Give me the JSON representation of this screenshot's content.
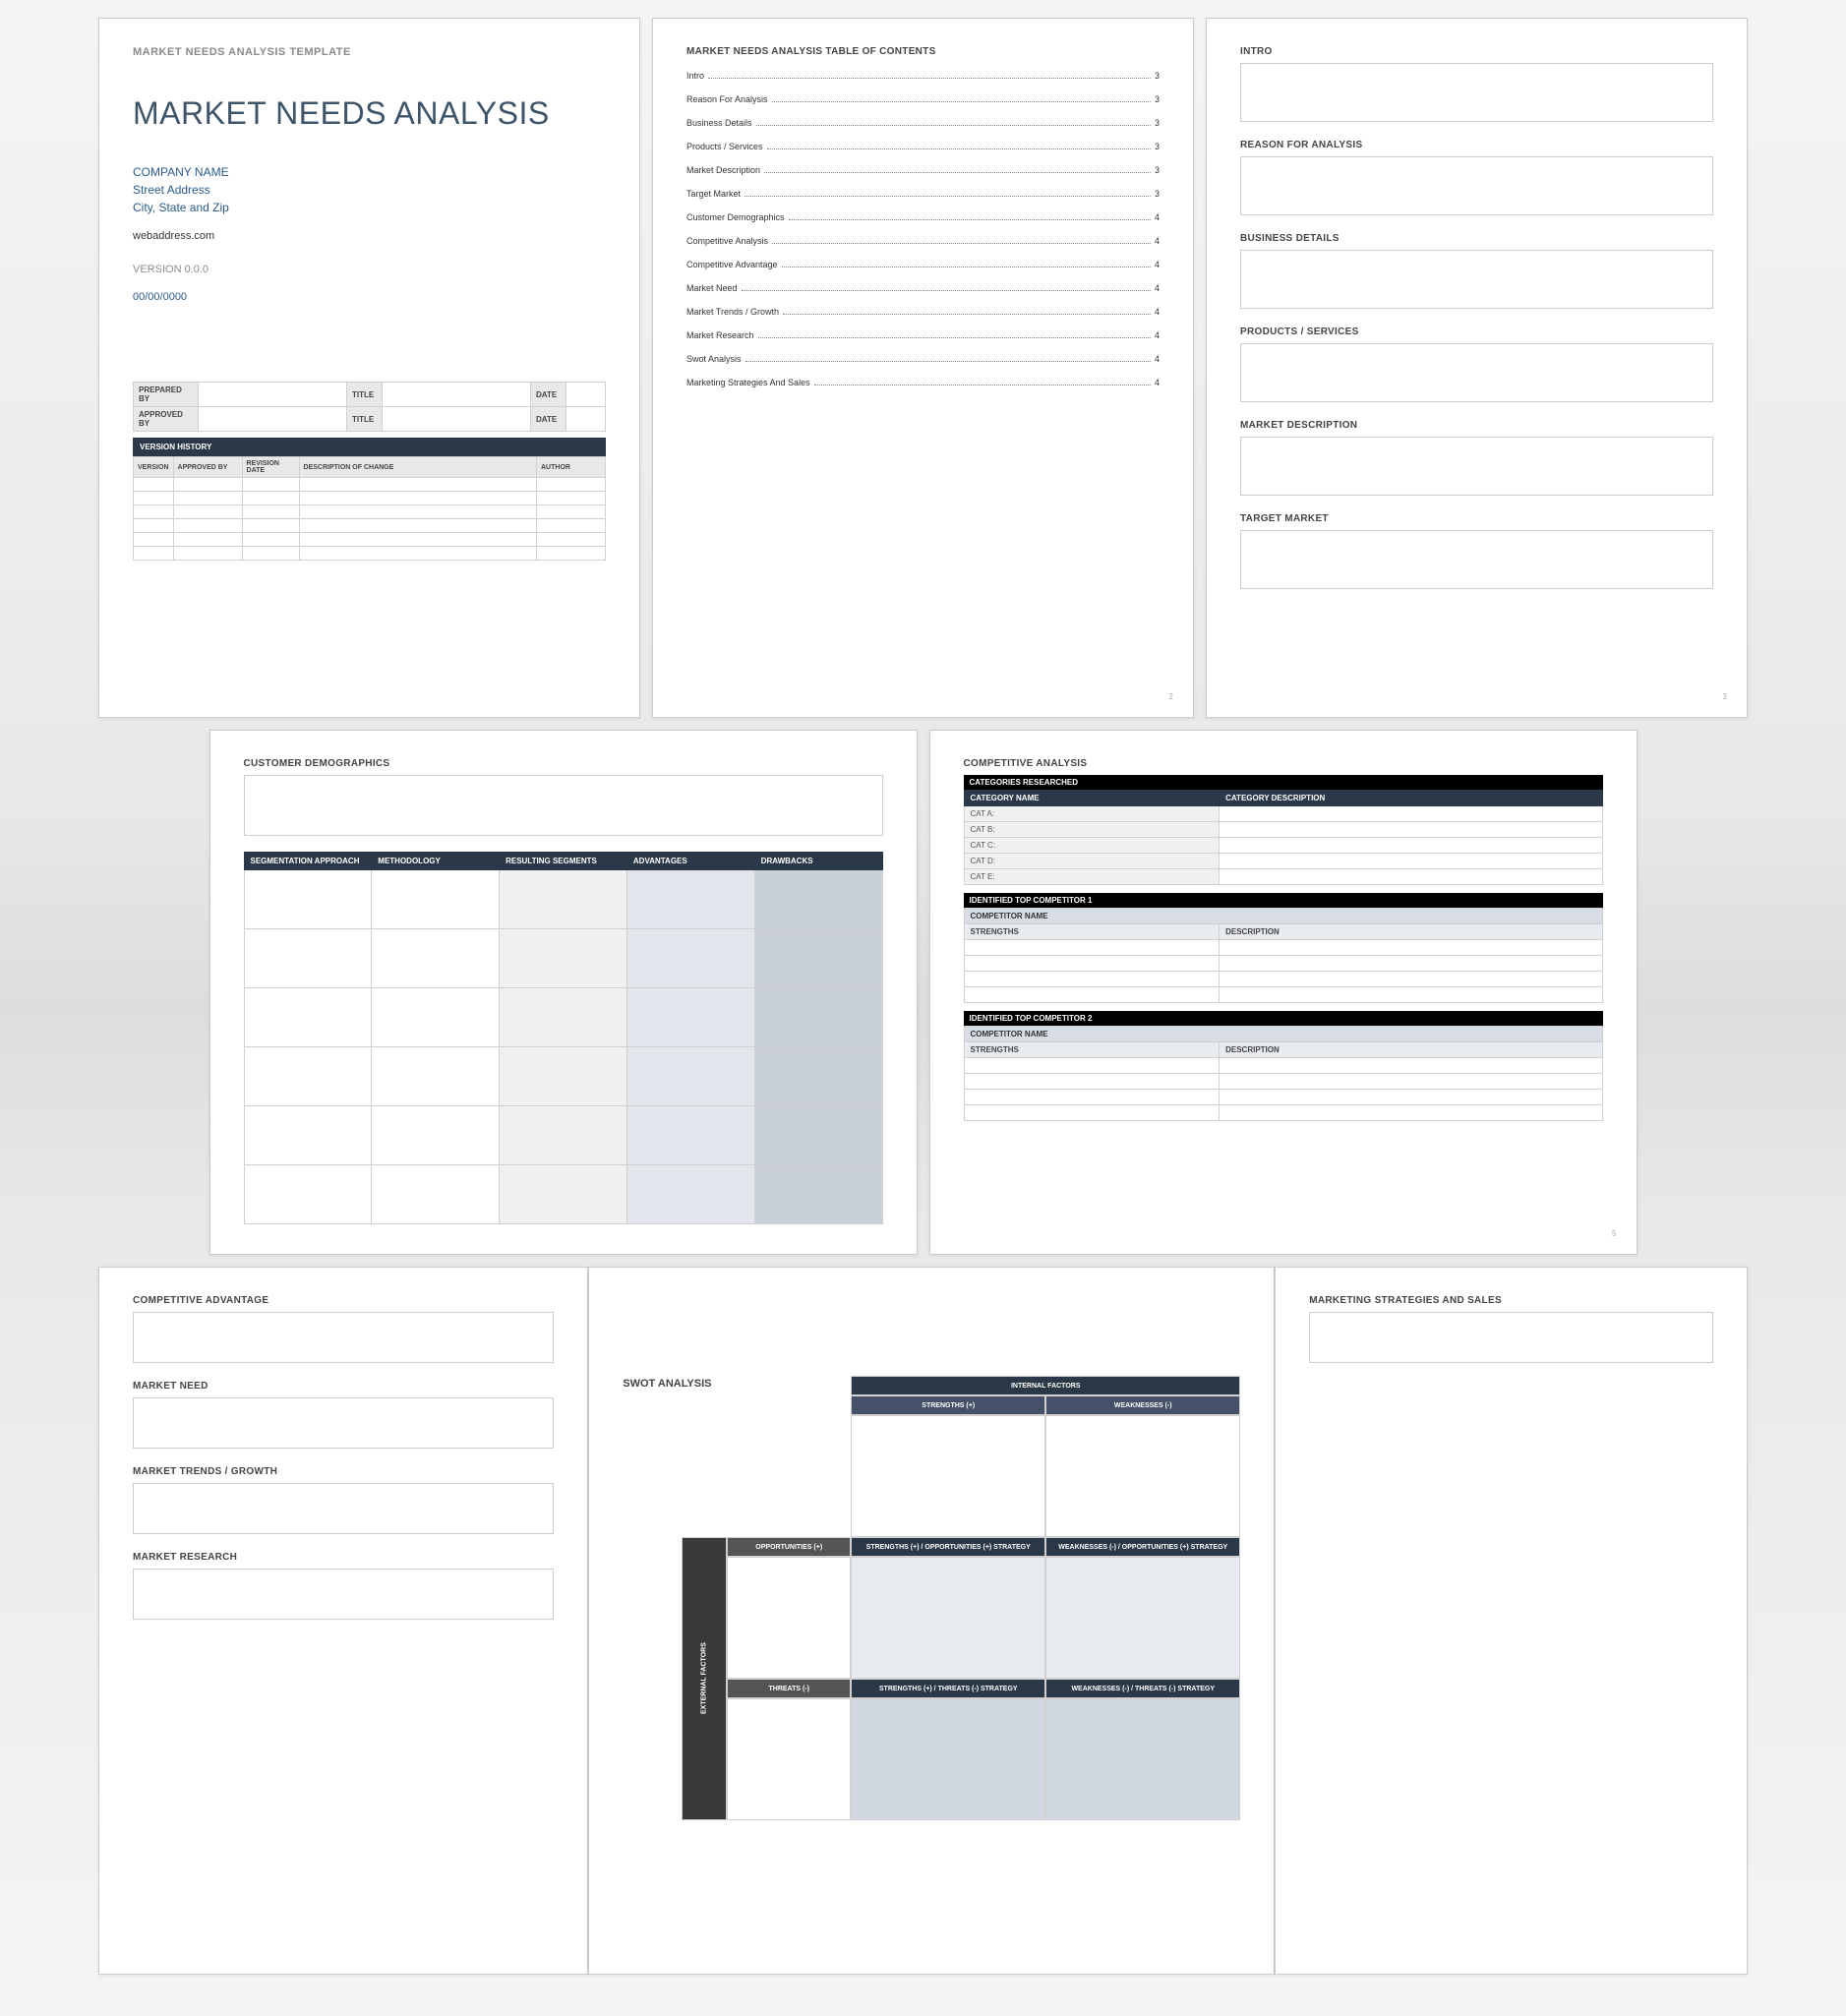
{
  "page1": {
    "template_label": "MARKET NEEDS ANALYSIS TEMPLATE",
    "title": "MARKET NEEDS ANALYSIS",
    "company_name": "COMPANY NAME",
    "street": "Street Address",
    "city": "City, State and Zip",
    "web": "webaddress.com",
    "version": "VERSION 0.0.0",
    "date": "00/00/0000",
    "meta": {
      "prepared_by": "PREPARED BY",
      "approved_by": "APPROVED BY",
      "title": "TITLE",
      "date": "DATE"
    },
    "version_history": {
      "header": "VERSION HISTORY",
      "cols": [
        "VERSION",
        "APPROVED BY",
        "REVISION DATE",
        "DESCRIPTION OF CHANGE",
        "AUTHOR"
      ]
    }
  },
  "page2": {
    "title": "MARKET NEEDS ANALYSIS TABLE OF CONTENTS",
    "items": [
      {
        "t": "Intro",
        "p": "3"
      },
      {
        "t": "Reason For Analysis",
        "p": "3"
      },
      {
        "t": "Business Details",
        "p": "3"
      },
      {
        "t": "Products / Services",
        "p": "3"
      },
      {
        "t": "Market Description",
        "p": "3"
      },
      {
        "t": "Target Market",
        "p": "3"
      },
      {
        "t": "Customer Demographics",
        "p": "4"
      },
      {
        "t": "Competitive Analysis",
        "p": "4"
      },
      {
        "t": "Competitive Advantage",
        "p": "4"
      },
      {
        "t": "Market Need",
        "p": "4"
      },
      {
        "t": "Market Trends / Growth",
        "p": "4"
      },
      {
        "t": "Market Research",
        "p": "4"
      },
      {
        "t": "Swot Analysis",
        "p": "4"
      },
      {
        "t": "Marketing Strategies And Sales",
        "p": "4"
      }
    ],
    "pagenum": "2"
  },
  "page3": {
    "sections": [
      "INTRO",
      "REASON FOR ANALYSIS",
      "BUSINESS DETAILS",
      "PRODUCTS / SERVICES",
      "MARKET DESCRIPTION",
      "TARGET MARKET"
    ],
    "pagenum": "3"
  },
  "page4": {
    "title": "CUSTOMER DEMOGRAPHICS",
    "cols": [
      "SEGMENTATION APPROACH",
      "METHODOLOGY",
      "RESULTING SEGMENTS",
      "ADVANTAGES",
      "DRAWBACKS"
    ]
  },
  "page5": {
    "title": "COMPETITIVE ANALYSIS",
    "cat_header": "CATEGORIES RESEARCHED",
    "cat_cols": [
      "CATEGORY NAME",
      "CATEGORY DESCRIPTION"
    ],
    "cats": [
      "CAT A:",
      "CAT B:",
      "CAT C:",
      "CAT D:",
      "CAT E:"
    ],
    "comp1_header": "IDENTIFIED TOP COMPETITOR 1",
    "comp2_header": "IDENTIFIED TOP COMPETITOR 2",
    "comp_name": "COMPETITOR NAME",
    "comp_cols": [
      "STRENGTHS",
      "DESCRIPTION"
    ],
    "pagenum": "5"
  },
  "page7": {
    "sections": [
      "COMPETITIVE ADVANTAGE",
      "MARKET NEED",
      "MARKET TRENDS / GROWTH",
      "MARKET RESEARCH"
    ]
  },
  "page8": {
    "title": "SWOT ANALYSIS",
    "internal": "INTERNAL   FACTORS",
    "external": "EXTERNAL FACTORS",
    "strengths": "STRENGTHS (+)",
    "weaknesses": "WEAKNESSES (-)",
    "opportunities": "OPPORTUNITIES (+)",
    "threats": "THREATS (-)",
    "so": "STRENGTHS (+) / OPPORTUNITIES (+) STRATEGY",
    "wo": "WEAKNESSES (-) / OPPORTUNITIES (+) STRATEGY",
    "st": "STRENGTHS (+) / THREATS (-) STRATEGY",
    "wt": "WEAKNESSES (-) / THREATS (-) STRATEGY"
  },
  "page9": {
    "title": "MARKETING STRATEGIES AND SALES"
  }
}
